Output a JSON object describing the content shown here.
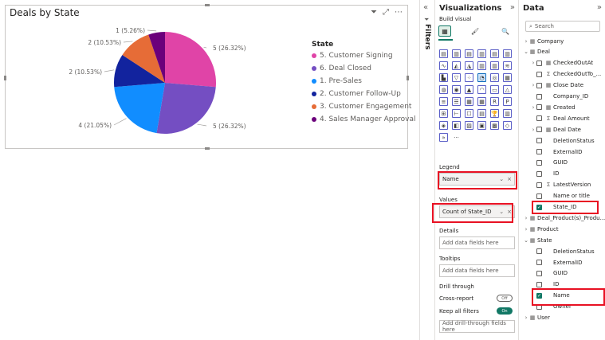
{
  "chart": {
    "title": "Deals by State",
    "legend_title": "State",
    "slice_labels": [
      "5 (26.32%)",
      "5 (26.32%)",
      "4 (21.05%)",
      "2 (10.53%)",
      "2 (10.53%)",
      "1 (5.26%)"
    ]
  },
  "chart_data": {
    "type": "pie",
    "title": "Deals by State",
    "legend_title": "State",
    "categories": [
      "5. Customer Signing",
      "6. Deal Closed",
      "1. Pre-Sales",
      "2. Customer Follow-Up",
      "3. Customer Engagement",
      "4. Sales Manager Approval"
    ],
    "values": [
      5,
      5,
      4,
      2,
      2,
      1
    ],
    "percentages": [
      "26.32%",
      "26.32%",
      "21.05%",
      "10.53%",
      "10.53%",
      "5.26%"
    ],
    "colors": [
      "#e044a7",
      "#744ec2",
      "#118dff",
      "#12239e",
      "#e66c37",
      "#6b007b"
    ],
    "legend_position": "right"
  },
  "visual_tools": {
    "filter_icon": "filter-icon",
    "focus_icon": "focus-mode-icon",
    "more_icon": "more-options-icon"
  },
  "filters": {
    "label": "Filters",
    "collapse": "«"
  },
  "viz_pane": {
    "title": "Visualizations",
    "collapse": "»",
    "build_label": "Build visual",
    "legend_label": "Legend",
    "legend_field": "Name",
    "values_label": "Values",
    "values_field": "Count of State_ID",
    "details_label": "Details",
    "details_placeholder": "Add data fields here",
    "tooltips_label": "Tooltips",
    "tooltips_placeholder": "Add data fields here",
    "drill_label": "Drill through",
    "cross_report_label": "Cross-report",
    "cross_report_state": "Off",
    "keep_filters_label": "Keep all filters",
    "keep_filters_state": "On",
    "drill_placeholder": "Add drill-through fields here",
    "more_visuals": "···"
  },
  "data_pane": {
    "title": "Data",
    "collapse": "»",
    "search_placeholder": "Search",
    "tree": [
      {
        "label": "Company",
        "type": "table",
        "expanded": false,
        "level": 0
      },
      {
        "label": "Deal",
        "type": "table",
        "expanded": true,
        "level": 0
      },
      {
        "label": "CheckedOutAt",
        "type": "date",
        "level": 1
      },
      {
        "label": "CheckedOutTo_...",
        "type": "sum",
        "level": 1
      },
      {
        "label": "Close Date",
        "type": "date",
        "level": 1
      },
      {
        "label": "Company_ID",
        "type": "field",
        "level": 1
      },
      {
        "label": "Created",
        "type": "date",
        "level": 1
      },
      {
        "label": "Deal Amount",
        "type": "sum",
        "level": 1
      },
      {
        "label": "Deal Date",
        "type": "date",
        "level": 1
      },
      {
        "label": "DeletionStatus",
        "type": "field",
        "level": 1
      },
      {
        "label": "ExternalID",
        "type": "field",
        "level": 1
      },
      {
        "label": "GUID",
        "type": "field",
        "level": 1
      },
      {
        "label": "ID",
        "type": "field",
        "level": 1
      },
      {
        "label": "LatestVersion",
        "type": "sum",
        "level": 1
      },
      {
        "label": "Name or title",
        "type": "field",
        "level": 1
      },
      {
        "label": "State_ID",
        "type": "field",
        "level": 1,
        "checked": true
      },
      {
        "label": "Deal_Product(s)_Produ...",
        "type": "table",
        "expanded": false,
        "level": 0
      },
      {
        "label": "Product",
        "type": "table",
        "expanded": false,
        "level": 0
      },
      {
        "label": "State",
        "type": "table",
        "expanded": true,
        "level": 0
      },
      {
        "label": "DeletionStatus",
        "type": "field",
        "level": 1
      },
      {
        "label": "ExternalID",
        "type": "field",
        "level": 1
      },
      {
        "label": "GUID",
        "type": "field",
        "level": 1
      },
      {
        "label": "ID",
        "type": "field",
        "level": 1
      },
      {
        "label": "Name",
        "type": "field",
        "level": 1,
        "checked": true
      },
      {
        "label": "Owner",
        "type": "field",
        "level": 1
      },
      {
        "label": "User",
        "type": "table",
        "expanded": false,
        "level": 0
      }
    ]
  }
}
